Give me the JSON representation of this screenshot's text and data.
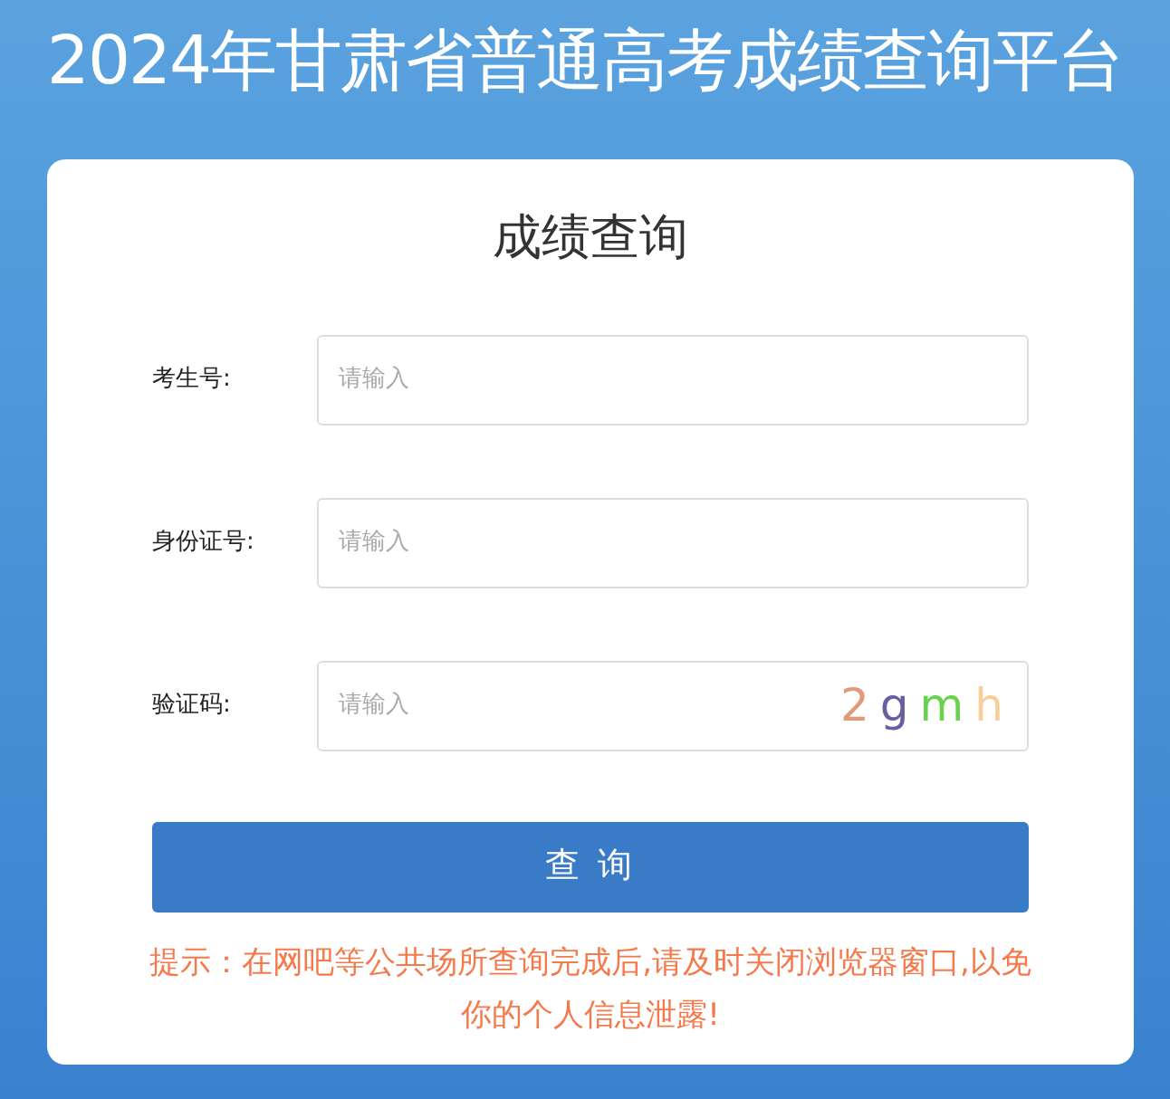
{
  "page_title": "2024年甘肃省普通高考成绩查询平台",
  "form": {
    "title": "成绩查询",
    "fields": [
      {
        "label": "考生号:",
        "placeholder": "请输入"
      },
      {
        "label": "身份证号:",
        "placeholder": "请输入"
      },
      {
        "label": "验证码:",
        "placeholder": "请输入",
        "captcha": [
          {
            "char": "2",
            "color": "#e09a7a"
          },
          {
            "char": "g",
            "color": "#6a5f9e"
          },
          {
            "char": "m",
            "color": "#66d34a"
          },
          {
            "char": "h",
            "color": "#f7cf9b"
          }
        ]
      }
    ],
    "submit": "查 询",
    "notice": "提示：在网吧等公共场所查询完成后,请及时关闭浏览器窗口,以免你的个人信息泄露!"
  }
}
